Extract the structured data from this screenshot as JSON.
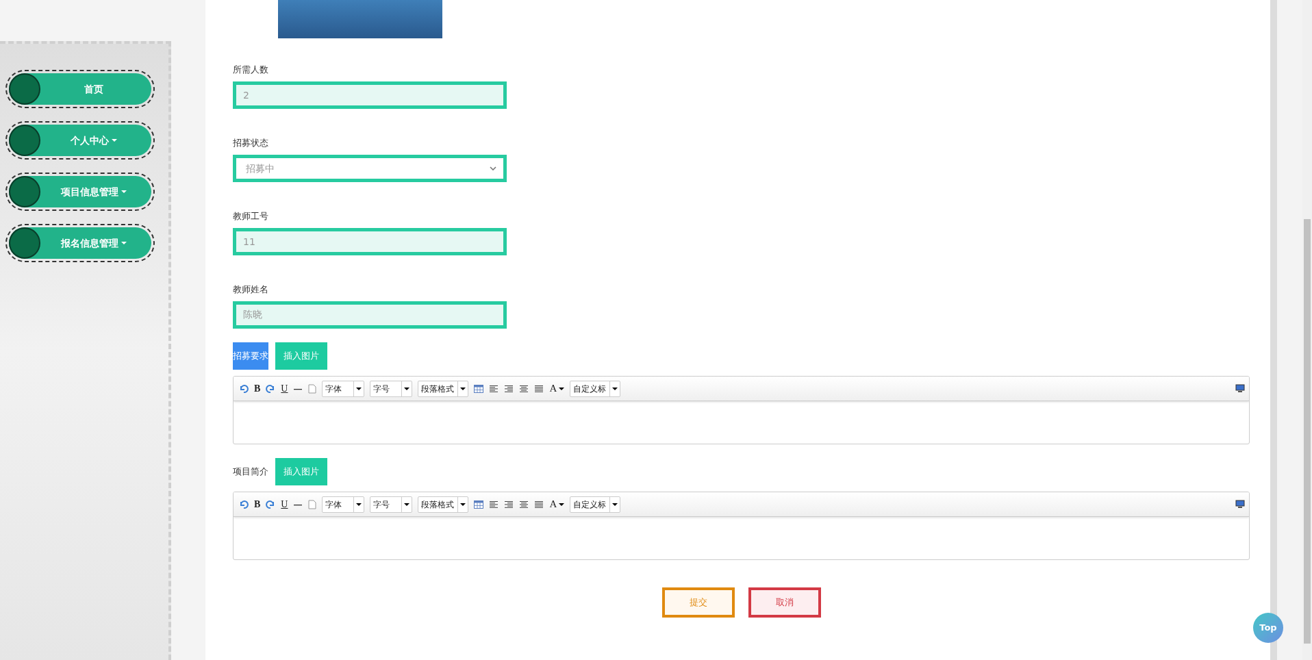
{
  "sidebar": {
    "items": [
      {
        "label": "首页",
        "dropdown": false
      },
      {
        "label": "个人中心",
        "dropdown": true
      },
      {
        "label": "项目信息管理",
        "dropdown": true
      },
      {
        "label": "报名信息管理",
        "dropdown": true
      }
    ]
  },
  "form": {
    "fields": [
      {
        "kind": "input",
        "label": "所需人数",
        "value": "2"
      },
      {
        "kind": "select",
        "label": "招募状态",
        "value": "招募中"
      },
      {
        "kind": "input",
        "label": "教师工号",
        "value": "11"
      },
      {
        "kind": "input",
        "label": "教师姓名",
        "value": "陈晓"
      }
    ],
    "editors": [
      {
        "label": "招募要求",
        "highlighted": true,
        "insert_button": "插入图片",
        "toolbar": {
          "bold": "B",
          "underline": "U",
          "font": "字体",
          "size": "字号",
          "paragraph": "段落格式",
          "font_color": "A",
          "custom_title": "自定义标"
        }
      },
      {
        "label": "项目简介",
        "highlighted": false,
        "insert_button": "插入图片",
        "toolbar": {
          "bold": "B",
          "underline": "U",
          "font": "字体",
          "size": "字号",
          "paragraph": "段落格式",
          "font_color": "A",
          "custom_title": "自定义标"
        }
      }
    ],
    "actions": [
      {
        "kind": "submit",
        "label": "提交"
      },
      {
        "kind": "cancel",
        "label": "取消"
      }
    ]
  },
  "back_to_top": "Top"
}
